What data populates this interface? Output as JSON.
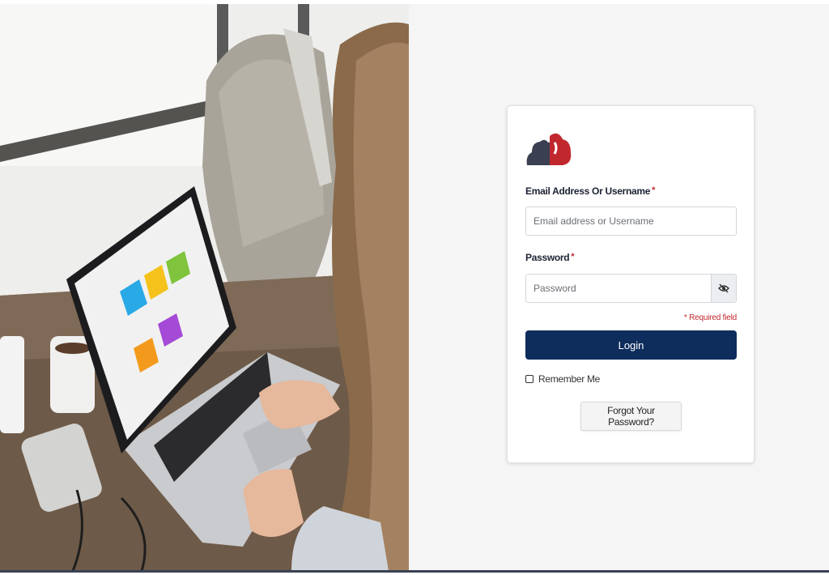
{
  "hero_image": {
    "alt_name": "woman-using-laptop-photo"
  },
  "login": {
    "logo_name": "company-cloud-logo",
    "email_label": "Email Address Or Username",
    "email_required_mark": "*",
    "email_placeholder": "Email address or Username",
    "email_value": "",
    "password_label": "Password",
    "password_required_mark": "*",
    "password_placeholder": "Password",
    "password_value": "",
    "toggle_icon": "eye-slash-icon",
    "required_note": "* Required field",
    "login_button": "Login",
    "remember_label": "Remember Me",
    "remember_checked": false,
    "forgot_button": "Forgot Your Password?"
  },
  "colors": {
    "primary": "#0e2d5c",
    "logo_dark": "#3a3f52",
    "logo_red": "#c0282e",
    "required_red": "#c0282e",
    "page_bg": "#f5f5f5"
  }
}
